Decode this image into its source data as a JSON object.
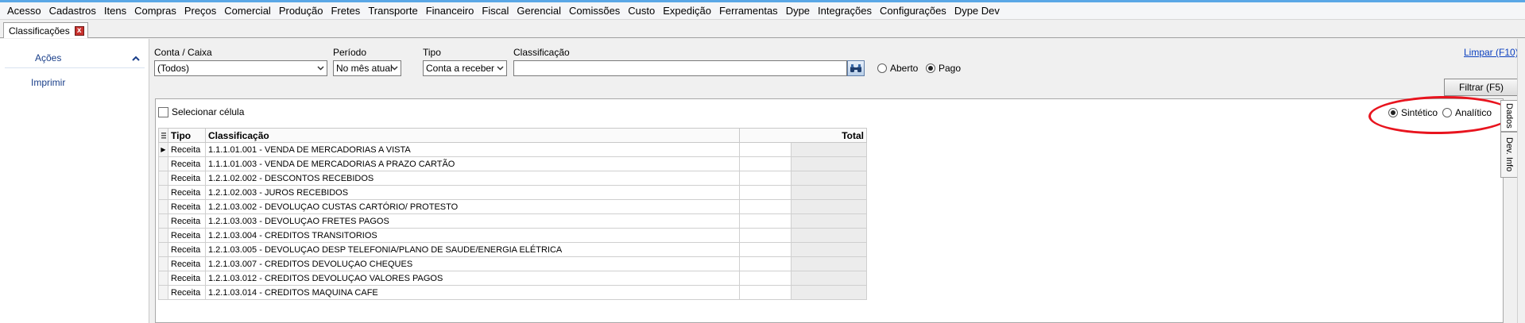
{
  "menu": [
    "Acesso",
    "Cadastros",
    "Itens",
    "Compras",
    "Preços",
    "Comercial",
    "Produção",
    "Fretes",
    "Transporte",
    "Financeiro",
    "Fiscal",
    "Gerencial",
    "Comissões",
    "Custo",
    "Expedição",
    "Ferramentas",
    "Dype",
    "Integrações",
    "Configurações",
    "Dype Dev"
  ],
  "tab": {
    "label": "Classificações",
    "close": "x"
  },
  "sidebar": {
    "header": "Ações",
    "items": [
      "Imprimir"
    ]
  },
  "filters": {
    "conta_label": "Conta / Caixa",
    "conta_value": "(Todos)",
    "periodo_label": "Período",
    "periodo_value": "No mês atual",
    "tipo_label": "Tipo",
    "tipo_value": "Conta a receber",
    "classificacao_label": "Classificação",
    "classificacao_value": "",
    "status_options": [
      {
        "label": "Aberto",
        "selected": false
      },
      {
        "label": "Pago",
        "selected": true
      }
    ],
    "clear_link": "Limpar (F10)",
    "filter_button": "Filtrar (F5)"
  },
  "panel": {
    "select_cell_label": "Selecionar célula",
    "view_options": [
      {
        "label": "Sintético",
        "selected": true
      },
      {
        "label": "Analítico",
        "selected": false
      }
    ],
    "side_tabs": [
      "Dados",
      "Dev. Info"
    ]
  },
  "grid": {
    "columns": [
      "Tipo",
      "Classificação",
      "Total"
    ],
    "rows": [
      {
        "tipo": "Receita",
        "classificacao": "1.1.1.01.001 - VENDA DE MERCADORIAS A VISTA",
        "total": ""
      },
      {
        "tipo": "Receita",
        "classificacao": "1.1.1.01.003 - VENDA DE MERCADORIAS A PRAZO CARTÃO",
        "total": ""
      },
      {
        "tipo": "Receita",
        "classificacao": "1.2.1.02.002 - DESCONTOS RECEBIDOS",
        "total": ""
      },
      {
        "tipo": "Receita",
        "classificacao": "1.2.1.02.003 - JUROS RECEBIDOS",
        "total": ""
      },
      {
        "tipo": "Receita",
        "classificacao": "1.2.1.03.002 - DEVOLUÇAO CUSTAS CARTÓRIO/ PROTESTO",
        "total": ""
      },
      {
        "tipo": "Receita",
        "classificacao": "1.2.1.03.003 - DEVOLUÇAO FRETES PAGOS",
        "total": ""
      },
      {
        "tipo": "Receita",
        "classificacao": "1.2.1.03.004 - CREDITOS TRANSITORIOS",
        "total": ""
      },
      {
        "tipo": "Receita",
        "classificacao": "1.2.1.03.005 - DEVOLUÇAO DESP TELEFONIA/PLANO DE SAUDE/ENERGIA ELÉTRICA",
        "total": ""
      },
      {
        "tipo": "Receita",
        "classificacao": "1.2.1.03.007 - CREDITOS DEVOLUÇAO CHEQUES",
        "total": ""
      },
      {
        "tipo": "Receita",
        "classificacao": "1.2.1.03.012 - CREDITOS DEVOLUÇAO VALORES PAGOS",
        "total": ""
      },
      {
        "tipo": "Receita",
        "classificacao": "1.2.1.03.014 - CREDITOS MAQUINA CAFE",
        "total": ""
      }
    ]
  },
  "colors": {
    "accent": "#1a3f8a",
    "annotation": "#e8141e",
    "link": "#0b3fbf"
  }
}
